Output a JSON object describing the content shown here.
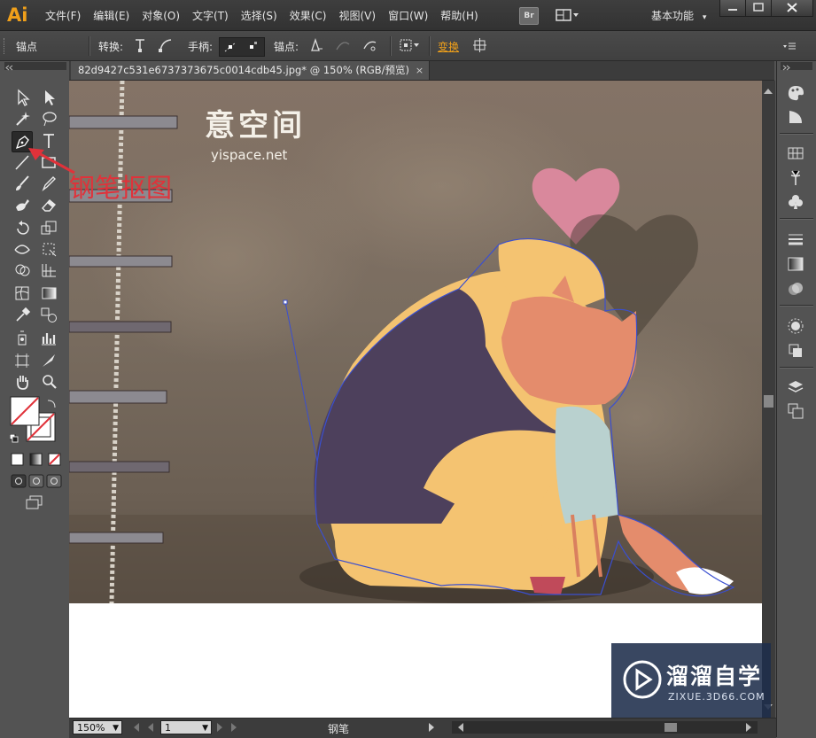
{
  "app": {
    "logo": "Ai"
  },
  "menu": [
    "文件(F)",
    "编辑(E)",
    "对象(O)",
    "文字(T)",
    "选择(S)",
    "效果(C)",
    "视图(V)",
    "窗口(W)",
    "帮助(H)"
  ],
  "menubar": {
    "bridge_label": "Br",
    "workspace": "基本功能"
  },
  "control_bar": {
    "selection_type": "锚点",
    "convert_label": "转换:",
    "handles_label": "手柄:",
    "anchors_label": "锚点:",
    "transform_label": "变换"
  },
  "document": {
    "tab_title": "82d9427c531e6737373675c0014cdb45.jpg* @ 150% (RGB/预览)",
    "tab_close": "×"
  },
  "artwork": {
    "logo_title": "意空间",
    "logo_url": "yispace.net",
    "annotation": "钢笔抠图"
  },
  "status_bar": {
    "zoom": "150%",
    "artboard": "1",
    "current_tool": "钢笔"
  },
  "watermark": {
    "title": "溜溜自学",
    "url": "ZIXUE.3D66.COM"
  },
  "colors": {
    "accent": "#f0a01a",
    "path_stroke": "#3a4fd0",
    "annotation_red": "#e0323a"
  }
}
